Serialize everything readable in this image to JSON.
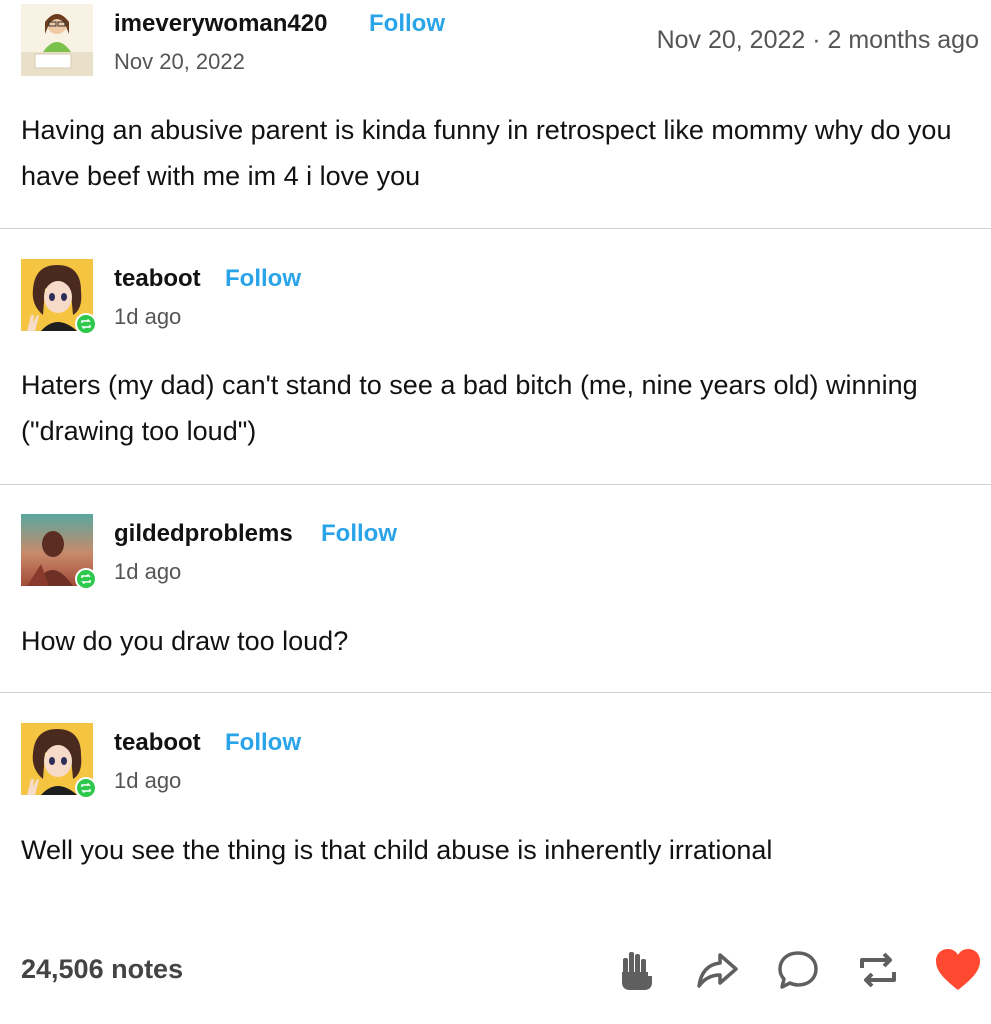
{
  "original_post": {
    "username": "imeverywoman420",
    "follow_label": "Follow",
    "date": "Nov 20, 2022",
    "timestamp": "Nov 20, 2022 · 2 months ago",
    "text": "Having an abusive parent is kinda funny in retrospect like mommy why do you have beef with me im 4 i love you"
  },
  "reblogs": [
    {
      "username": "teaboot",
      "follow_label": "Follow",
      "time": "1d ago",
      "text": "Haters (my dad) can't stand to see a bad bitch (me, nine years old) winning (\"drawing too loud\")"
    },
    {
      "username": "gildedproblems",
      "follow_label": "Follow",
      "time": "1d ago",
      "text": "How do you draw too loud?"
    },
    {
      "username": "teaboot",
      "follow_label": "Follow",
      "time": "1d ago",
      "text": "Well you see the thing is that child abuse is inherently irrational"
    }
  ],
  "footer": {
    "notes": "24,506 notes",
    "actions": [
      "hand-icon",
      "share-icon",
      "reply-icon",
      "reblog-icon",
      "like-icon"
    ],
    "like_color": "#ff4930"
  },
  "colors": {
    "follow": "#2aa4e8",
    "reblog_badge": "#2ec84d",
    "divider": "#d0d0d0"
  }
}
